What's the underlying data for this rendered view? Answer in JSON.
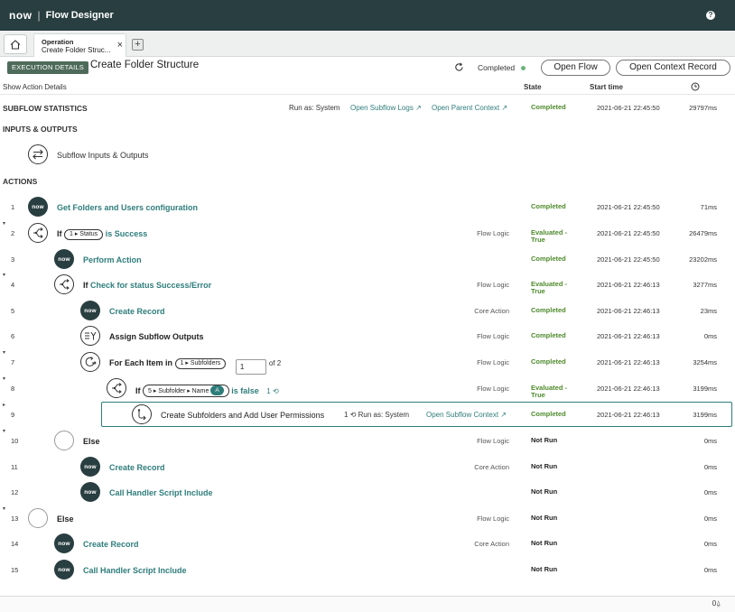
{
  "topbar": {
    "logo": "now",
    "app_title": "Flow Designer",
    "help_label": "?"
  },
  "tabbar": {
    "tab": {
      "line1": "Operation",
      "line2": "Create Folder Struc..."
    },
    "close_glyph": "×",
    "add_glyph": "+"
  },
  "header": {
    "badge": "EXECUTION DETAILS",
    "title": "Create Folder Structure",
    "status": "Completed",
    "open_flow": "Open Flow",
    "open_context_record": "Open Context Record"
  },
  "columns": {
    "show_action_details": "Show Action Details",
    "state": "State",
    "start_time": "Start time"
  },
  "subflow_stats": {
    "label": "SUBFLOW STATISTICS",
    "run_as": "Run as: System",
    "open_logs": "Open Subflow Logs",
    "open_parent": "Open Parent Context",
    "state": "Completed",
    "start": "2021-06-21 22:45:50",
    "duration": "29797ms"
  },
  "sections": {
    "inputs_outputs": "INPUTS & OUTPUTS",
    "io_label": "Subflow Inputs & Outputs",
    "actions": "ACTIONS"
  },
  "rows": [
    {
      "num": "1",
      "name": "Get Folders and Users configuration",
      "type": "",
      "state": "Completed",
      "start": "2021-06-21 22:45:50",
      "dur": "71ms"
    },
    {
      "num": "2",
      "kw": "If",
      "pill": "1 ▸ Status",
      "tail": "is Success",
      "type": "Flow Logic",
      "state_l1": "Evaluated -",
      "state_l2": "True",
      "start": "2021-06-21 22:45:50",
      "dur": "26479ms"
    },
    {
      "num": "3",
      "name": "Perform Action",
      "type": "",
      "state": "Completed",
      "start": "2021-06-21 22:45:50",
      "dur": "23202ms"
    },
    {
      "num": "4",
      "kw": "If",
      "tail": "Check for status Success/Error",
      "type": "Flow Logic",
      "state_l1": "Evaluated -",
      "state_l2": "True",
      "start": "2021-06-21 22:46:13",
      "dur": "3277ms"
    },
    {
      "num": "5",
      "name": "Create Record",
      "type": "Core Action",
      "state": "Completed",
      "start": "2021-06-21 22:46:13",
      "dur": "23ms"
    },
    {
      "num": "6",
      "name": "Assign Subflow Outputs",
      "type": "Flow Logic",
      "state": "Completed",
      "start": "2021-06-21 22:46:13",
      "dur": "0ms"
    },
    {
      "num": "7",
      "kw": "For Each Item in",
      "pill": "1 ▸ Subfolders",
      "box": "1",
      "of": "of 2",
      "type": "Flow Logic",
      "state": "Completed",
      "start": "2021-06-21 22:46:13",
      "dur": "3254ms"
    },
    {
      "num": "8",
      "kw": "If",
      "pill": "5 ▸ Subfolder ▸ Name",
      "badge": "A",
      "tail": "is false",
      "iter": "1",
      "type": "Flow Logic",
      "state_l1": "Evaluated -",
      "state_l2": "True",
      "start": "2021-06-21 22:46:13",
      "dur": "3199ms"
    },
    {
      "num": "9",
      "name": "Create Subfolders and Add User Permissions",
      "iter": "1",
      "run_as": "Run as: System",
      "link": "Open Subflow Context",
      "state": "Completed",
      "start": "2021-06-21 22:46:13",
      "dur": "3199ms"
    },
    {
      "num": "10",
      "name": "Else",
      "type": "Flow Logic",
      "state": "Not Run",
      "start": "",
      "dur": "0ms"
    },
    {
      "num": "11",
      "name": "Create Record",
      "type": "Core Action",
      "state": "Not Run",
      "start": "",
      "dur": "0ms"
    },
    {
      "num": "12",
      "name": "Call Handler Script Include",
      "type": "",
      "state": "Not Run",
      "start": "",
      "dur": "0ms"
    },
    {
      "num": "13",
      "name": "Else",
      "type": "Flow Logic",
      "state": "Not Run",
      "start": "",
      "dur": "0ms"
    },
    {
      "num": "14",
      "name": "Create Record",
      "type": "Core Action",
      "state": "Not Run",
      "start": "",
      "dur": "0ms"
    },
    {
      "num": "15",
      "name": "Call Handler Script Include",
      "type": "",
      "state": "Not Run",
      "start": "",
      "dur": "0ms"
    }
  ],
  "footer": {
    "counter": "0"
  },
  "colors": {
    "brand_dark": "#293e40",
    "accent_teal": "#2e7d7b",
    "success_green": "#4e8a2c"
  }
}
